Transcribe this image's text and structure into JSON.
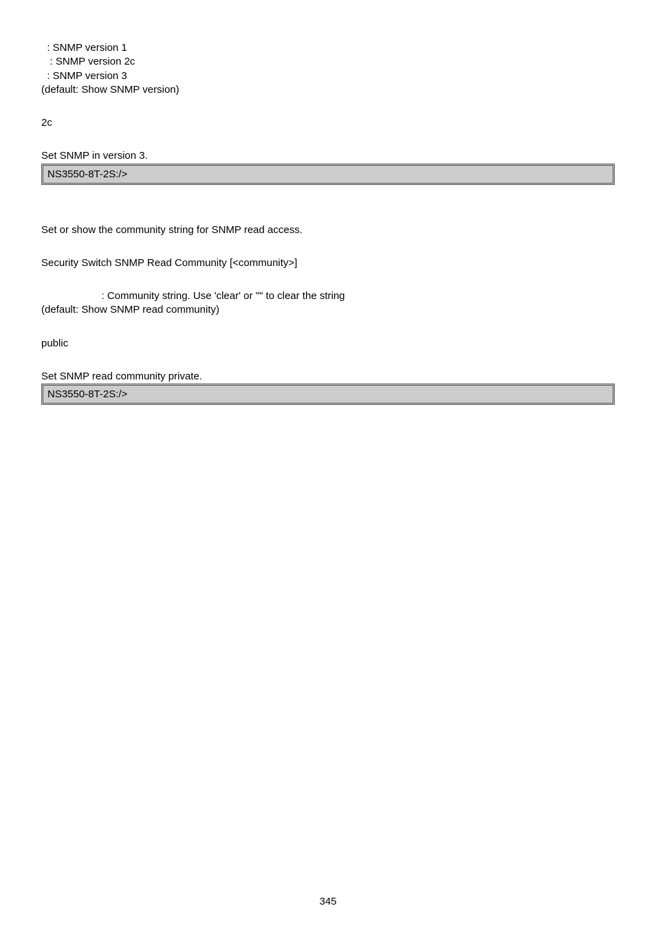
{
  "section1": {
    "line1": "  : SNMP version 1",
    "line2": "   : SNMP version 2c",
    "line3": "  : SNMP version 3",
    "line4": "(default: Show SNMP version)",
    "value": "2c",
    "exampleDesc": "Set SNMP in version 3.",
    "prompt": "NS3550-8T-2S:/>"
  },
  "section2": {
    "desc": "Set or show the community string for SNMP read access.",
    "syntax": "Security Switch SNMP Read Community [<community>]",
    "paramLine1": "                     : Community string. Use 'clear' or \"\" to clear the string",
    "paramLine2": "(default: Show SNMP read community)",
    "value": "public",
    "exampleDesc": "Set SNMP read community private.",
    "prompt": "NS3550-8T-2S:/>"
  },
  "pageNumber": "345"
}
